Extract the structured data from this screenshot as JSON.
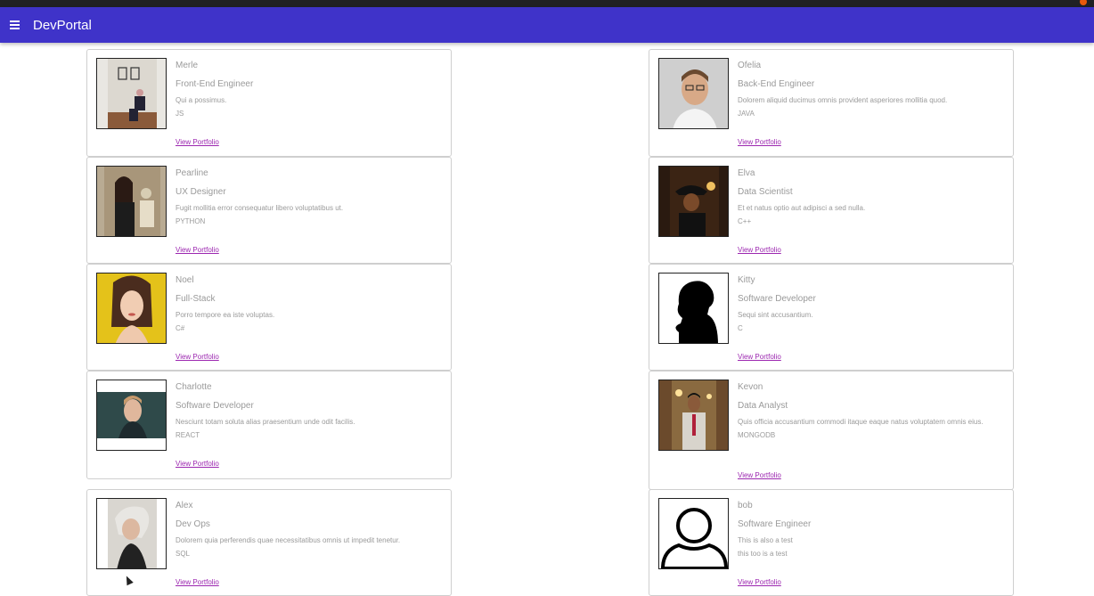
{
  "app": {
    "title": "DevPortal"
  },
  "icons": {
    "menu": "hamburger-menu-icon",
    "default_avatar": "user-outline-icon"
  },
  "colors": {
    "appbar": "#3f33c9",
    "link": "#9c27b0",
    "text": "#9a9a9a"
  },
  "developers": [
    {
      "name": "Merle",
      "role": "Front-End Engineer",
      "desc": "Qui a possimus.",
      "skill": "JS",
      "link": "View Portfolio"
    },
    {
      "name": "Ofelia",
      "role": "Back-End Engineer",
      "desc": "Dolorem aliquid ducimus omnis provident asperiores mollitia quod.",
      "skill": "JAVA",
      "link": "View Portfolio"
    },
    {
      "name": "Pearline",
      "role": "UX Designer",
      "desc": "Fugit mollitia error consequatur libero voluptatibus ut.",
      "skill": "PYTHON",
      "link": "View Portfolio"
    },
    {
      "name": "Elva",
      "role": "Data Scientist",
      "desc": "Et et natus optio aut adipisci a sed nulla.",
      "skill": "C++",
      "link": "View Portfolio"
    },
    {
      "name": "Noel",
      "role": "Full-Stack",
      "desc": "Porro tempore ea iste voluptas.",
      "skill": "C#",
      "link": "View Portfolio"
    },
    {
      "name": "Kitty",
      "role": "Software Developer",
      "desc": "Sequi sint accusantium.",
      "skill": "C",
      "link": "View Portfolio"
    },
    {
      "name": "Charlotte",
      "role": "Software Developer",
      "desc": "Nesciunt totam soluta alias praesentium unde odit facilis.",
      "skill": "REACT",
      "link": "View Portfolio"
    },
    {
      "name": "Kevon",
      "role": "Data Analyst",
      "desc": "Quis officia accusantium commodi itaque eaque natus voluptatem omnis eius.",
      "skill": "MONGODB",
      "link": "View Portfolio"
    },
    {
      "name": "Alex",
      "role": "Dev Ops",
      "desc": "Dolorem quia perferendis quae necessitatibus omnis ut impedit tenetur.",
      "skill": "SQL",
      "link": "View Portfolio"
    },
    {
      "name": "bob",
      "role": "Software Engineer",
      "desc": "This is also a test",
      "skill": "this too is a test",
      "link": "View Portfolio"
    }
  ]
}
